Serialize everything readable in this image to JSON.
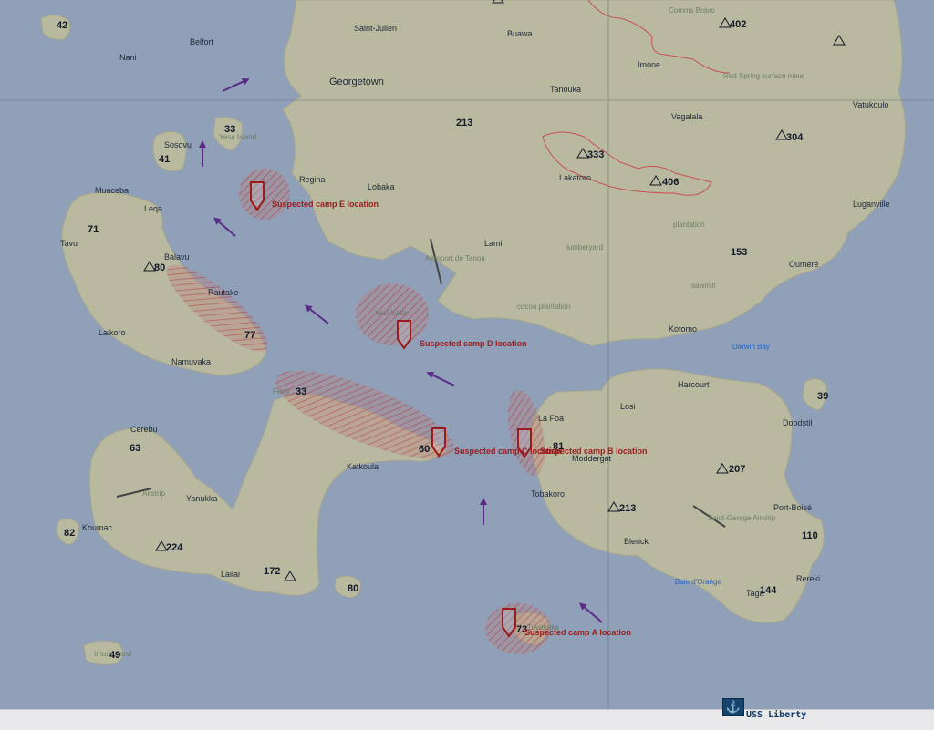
{
  "map": {
    "place_names": {
      "saint_julien": "Saint-Julien",
      "buawa": "Buawa",
      "belfort": "Belfort",
      "nani": "Nani",
      "imone": "Imone",
      "georgetown": "Georgetown",
      "tanouka": "Tanouka",
      "vagalala": "Vagalala",
      "vatukoulo": "Vatukoulo",
      "sosovu": "Sosovu",
      "yasa_island": "Yasa Island",
      "regina": "Regina",
      "lobaka": "Lobaka",
      "lakatoro": "Lakatoro",
      "muaceba": "Muaceba",
      "leqa": "Leqa",
      "luganville": "Luganville",
      "tavu": "Tavu",
      "balavu": "Balavu",
      "lami": "Lami",
      "aeroport_de_tanoa": "Aéroport de Tanoa",
      "oumere": "Ouméré",
      "rautake": "Rautake",
      "yasi_islets": "Yasi Islets",
      "laikoro": "Laikoro",
      "namuvaka": "Namuvaka",
      "kotomo": "Kotomo",
      "darwin_bay": "Darwin Bay",
      "ferry": "Ferry",
      "harcourt": "Harcourt",
      "losi": "Losi",
      "doodstil": "Doodstil",
      "la_foa": "La Foa",
      "cerebu": "Cerebu",
      "moddergat": "Moddergat",
      "katkoula": "Katkoula",
      "tobakoro": "Tobakoro",
      "yanukka": "Yanukka",
      "port_boise": "Port-Boisé",
      "koumac": "Koumac",
      "blerick": "Blerick",
      "lailai": "Lailai",
      "baie_d_orange": "Baie d'Orange",
      "rereki": "Rereki",
      "taga": "Taga",
      "imuri_island": "Imuri Island",
      "tuvanaka": "Tuvanaka",
      "cobalt_airstrip": "Airstrip",
      "st_george_airstrip": "Saint-George Airstrip",
      "plantation": "plantation",
      "lumberyard": "lumberyard",
      "sawmill": "sawmill",
      "cocoa_plantation": "cocoa plantation",
      "comms_bravo": "Comms Bravo",
      "red_spring": "Red Spring surface mine"
    },
    "elevations": {
      "h42": "42",
      "h402": "402",
      "h33n": "33",
      "h213n": "213",
      "h333": "333",
      "h304": "304",
      "h41": "41",
      "h406": "406",
      "h71": "71",
      "h80w": "80",
      "h153": "153",
      "h77": "77",
      "h33f": "33",
      "h39": "39",
      "h63": "63",
      "h60": "60",
      "h81": "81",
      "h207": "207",
      "h213s": "213",
      "h82": "82",
      "h224": "224",
      "h110": "110",
      "h172": "172",
      "h80s": "80",
      "h144": "144",
      "h49": "49",
      "h73": "73"
    },
    "markers": {
      "camp_e": "Suspected camp E location",
      "camp_d": "Suspected camp D location",
      "camp_c": "Suspected camp C location",
      "camp_b": "Suspected camp B location",
      "camp_a": "Suspected camp A location"
    },
    "unit": {
      "label": "USS Liberty",
      "icon": "anchor-icon"
    },
    "colors": {
      "water": "#8fa0b8",
      "land": "#b9b9a0",
      "marker": "#9b1b1b",
      "arrow": "#5b2a86",
      "unit": "#14456e"
    }
  }
}
